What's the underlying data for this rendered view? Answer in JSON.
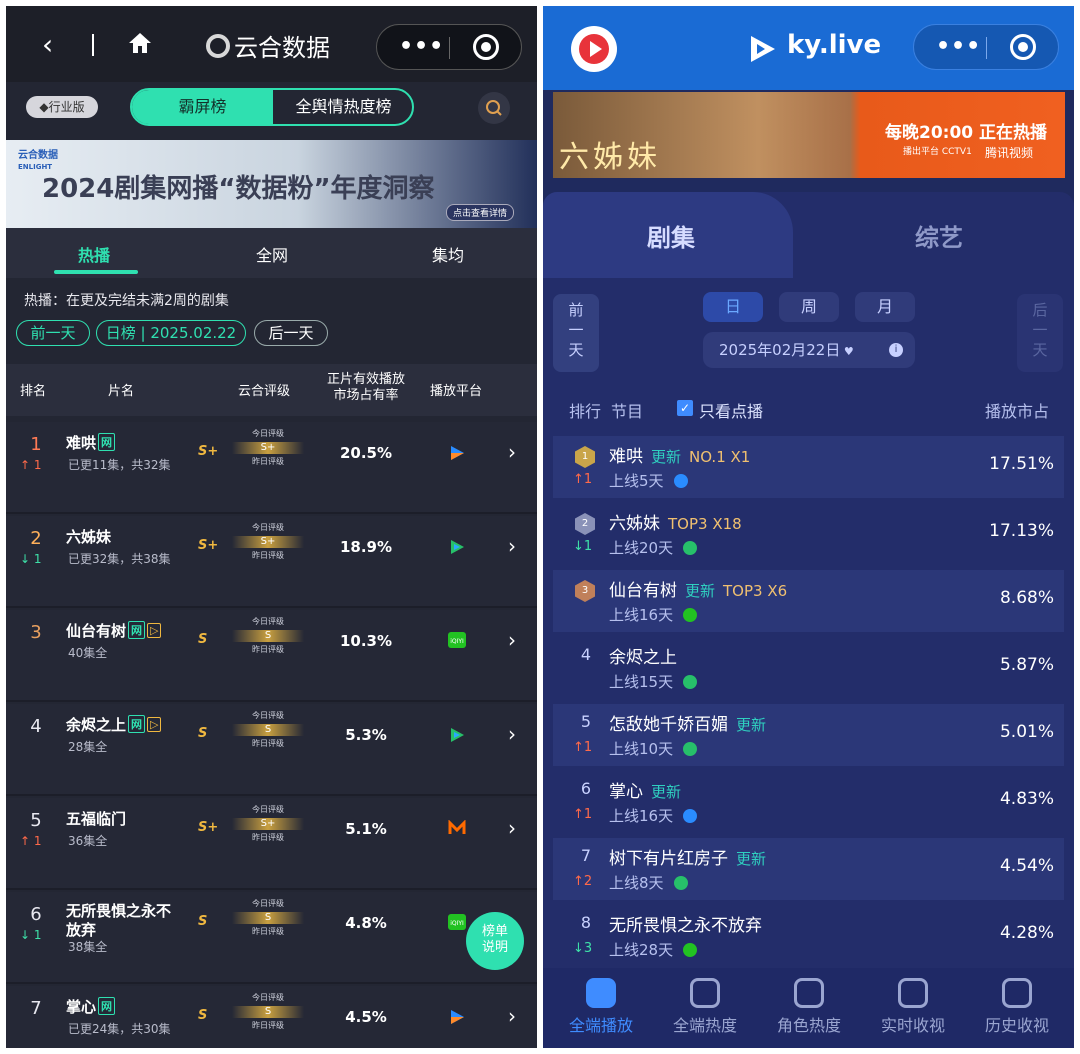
{
  "left": {
    "brand": "云合数据",
    "edition_badge": "行业版",
    "top_tabs": [
      "霸屏榜",
      "全舆情热度榜"
    ],
    "banner": {
      "logo_text": "云合数据",
      "logo_sub": "ENLIGHT",
      "title": "2024剧集网播“数据粉”年度洞察",
      "cta": "点击查看详情"
    },
    "sub_tabs": [
      "热播",
      "全网",
      "集均"
    ],
    "desc": "热播：在更及完结未满2周的剧集",
    "date_nav": {
      "prev": "前一天",
      "current": "日榜 | 2025.02.22",
      "next": "后一天"
    },
    "columns": [
      "排名",
      "片名",
      "云合评级",
      "正片有效播放\n市场占有率",
      "播放平台"
    ],
    "grade_labels": {
      "today": "今日评级",
      "yesterday": "昨日评级"
    },
    "rows": [
      {
        "rank": "1",
        "change": "↑ 1",
        "dir": "up",
        "name": "难哄",
        "tags": [
          "网"
        ],
        "sub": "已更11集，共32集",
        "grade": "S+",
        "today": "S+",
        "pct": "20.5%",
        "platform": "youku"
      },
      {
        "rank": "2",
        "change": "↓ 1",
        "dir": "dn",
        "name": "六姊妹",
        "tags": [],
        "sub": "已更32集，共38集",
        "grade": "S+",
        "today": "S+",
        "pct": "18.9%",
        "platform": "tencent"
      },
      {
        "rank": "3",
        "change": "",
        "dir": "",
        "name": "仙台有树",
        "tags": [
          "网",
          "▷"
        ],
        "sub": "40集全",
        "grade": "S",
        "today": "S",
        "pct": "10.3%",
        "platform": "iqiyi"
      },
      {
        "rank": "4",
        "change": "",
        "dir": "",
        "name": "余烬之上",
        "tags": [
          "网",
          "▷"
        ],
        "sub": "28集全",
        "grade": "S",
        "today": "S",
        "pct": "5.3%",
        "platform": "tencent"
      },
      {
        "rank": "5",
        "change": "↑ 1",
        "dir": "up",
        "name": "五福临门",
        "tags": [],
        "sub": "36集全",
        "grade": "S+",
        "today": "S+",
        "pct": "5.1%",
        "platform": "mango"
      },
      {
        "rank": "6",
        "change": "↓ 1",
        "dir": "dn",
        "name": "无所畏惧之永不放弃",
        "tags": [],
        "sub": "38集全",
        "grade": "S",
        "today": "S",
        "pct": "4.8%",
        "platform": "iqiyi"
      },
      {
        "rank": "7",
        "change": "",
        "dir": "",
        "name": "掌心",
        "tags": [
          "网"
        ],
        "sub": "已更24集，共30集",
        "grade": "S",
        "today": "S",
        "pct": "4.5%",
        "platform": "youku"
      }
    ],
    "float_button": "榜单说明",
    "watermark": "云合数据 ENLIGHTENT"
  },
  "right": {
    "brand": "ky.live",
    "banner": {
      "show": "六姊妹",
      "slogan": "每晚20:00 正在热播",
      "channel": "播出平台 CCTV1",
      "partner": "腾讯视频"
    },
    "main_tabs": [
      "剧集",
      "综艺"
    ],
    "prev_day": "前一天",
    "next_day": "后一天",
    "period_tabs": [
      "日",
      "周",
      "月"
    ],
    "date": "2025年02月22日",
    "col_rank": "排行",
    "col_show": "节目",
    "filter_label": "只看点播",
    "col_share": "播放市占",
    "rows": [
      {
        "rank": "1",
        "medal": "gold",
        "change": "↑1",
        "dir": "up",
        "name": "难哄",
        "tags": [
          {
            "t": "更新",
            "k": "U"
          },
          {
            "t": "NO.1 X1",
            "k": "T"
          }
        ],
        "sub": "上线5天",
        "platform": "youku",
        "pct": "17.51%"
      },
      {
        "rank": "2",
        "medal": "silver",
        "change": "↓1",
        "dir": "dn",
        "name": "六姊妹",
        "tags": [
          {
            "t": "TOP3 X18",
            "k": "T"
          }
        ],
        "sub": "上线20天",
        "platform": "tencent",
        "pct": "17.13%"
      },
      {
        "rank": "3",
        "medal": "bronze",
        "change": "",
        "dir": "",
        "name": "仙台有树",
        "tags": [
          {
            "t": "更新",
            "k": "U"
          },
          {
            "t": "TOP3 X6",
            "k": "T"
          }
        ],
        "sub": "上线16天",
        "platform": "iqiyi",
        "pct": "8.68%"
      },
      {
        "rank": "4",
        "medal": "",
        "change": "",
        "dir": "",
        "name": "余烬之上",
        "tags": [],
        "sub": "上线15天",
        "platform": "tencent",
        "pct": "5.87%"
      },
      {
        "rank": "5",
        "medal": "",
        "change": "↑1",
        "dir": "up",
        "name": "怎敌她千娇百媚",
        "tags": [
          {
            "t": "更新",
            "k": "U"
          }
        ],
        "sub": "上线10天",
        "platform": "tencent",
        "pct": "5.01%"
      },
      {
        "rank": "6",
        "medal": "",
        "change": "↑1",
        "dir": "up",
        "name": "掌心",
        "tags": [
          {
            "t": "更新",
            "k": "U"
          }
        ],
        "sub": "上线16天",
        "platform": "youku",
        "pct": "4.83%"
      },
      {
        "rank": "7",
        "medal": "",
        "change": "↑2",
        "dir": "up",
        "name": "树下有片红房子",
        "tags": [
          {
            "t": "更新",
            "k": "U"
          }
        ],
        "sub": "上线8天",
        "platform": "tencent",
        "pct": "4.54%"
      },
      {
        "rank": "8",
        "medal": "",
        "change": "↓3",
        "dir": "dn",
        "name": "无所畏惧之永不放弃",
        "tags": [],
        "sub": "上线28天",
        "platform": "iqiyi",
        "pct": "4.28%"
      }
    ],
    "bottom_nav": [
      "全端播放",
      "全端热度",
      "角色热度",
      "实时收视",
      "历史收视"
    ],
    "watermark": "ky.live"
  },
  "colors": {
    "teal": "#2fe0b0",
    "gold": "#f0b840",
    "up": "#ff6a4a",
    "down": "#3ee0a8",
    "youku": "#2a8cff",
    "tencent": "#27c06a",
    "iqiyi": "#22c222",
    "mango": "#ff6a00"
  }
}
